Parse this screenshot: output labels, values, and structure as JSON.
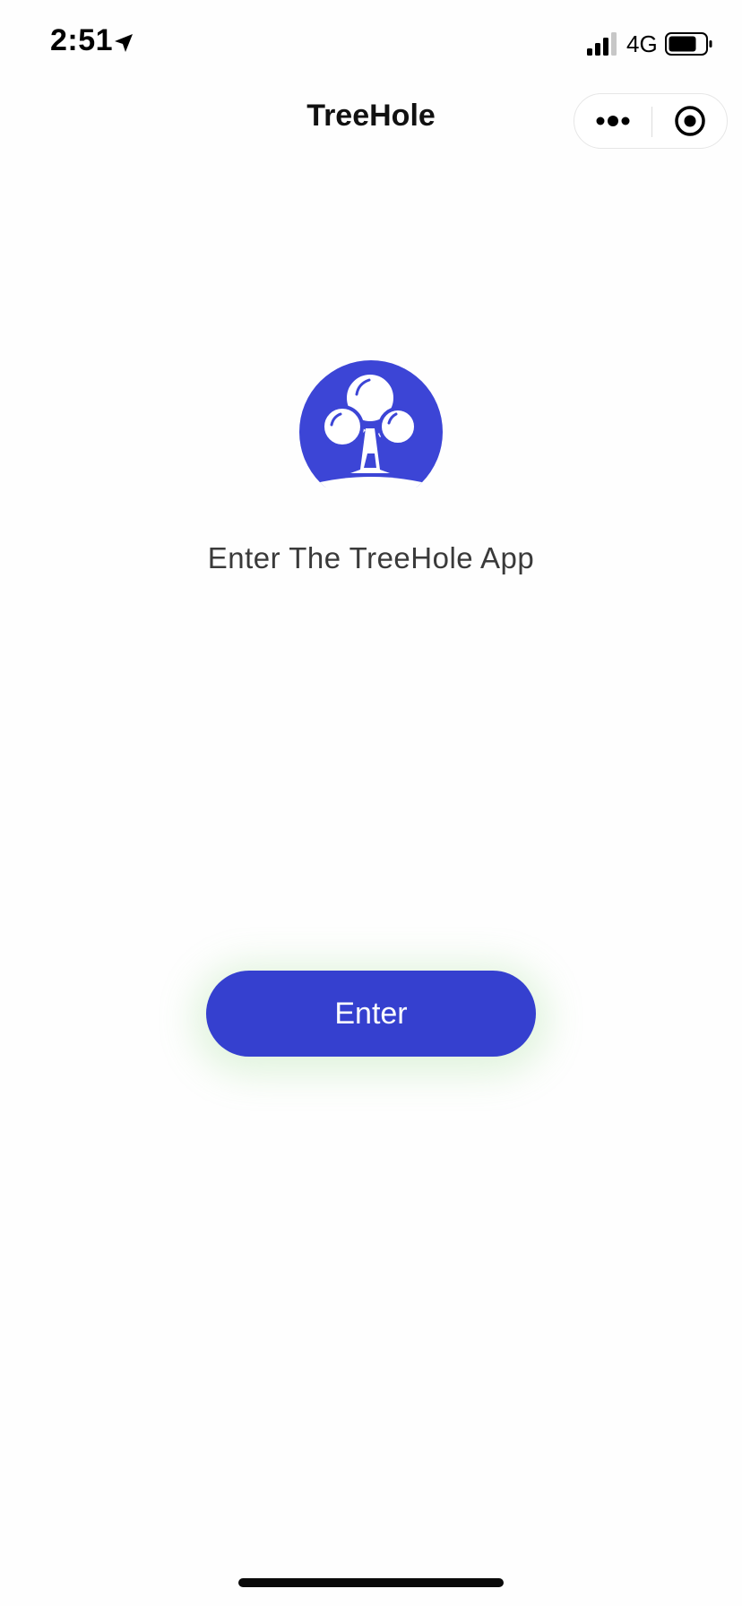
{
  "status_bar": {
    "time": "2:51",
    "network": "4G",
    "icons": [
      "location-arrow-icon",
      "cellular-signal-icon",
      "battery-icon"
    ]
  },
  "nav": {
    "title": "TreeHole",
    "more_icon": "more-dots-icon",
    "close_icon": "target-close-icon"
  },
  "main": {
    "logo_icon": "tree-logo-icon",
    "tagline": "Enter The TreeHole App",
    "enter_label": "Enter"
  },
  "colors": {
    "brand": "#3c45d6",
    "button": "#3540cf",
    "button_glow": "#96dc8c",
    "text": "#3a3a3a"
  }
}
